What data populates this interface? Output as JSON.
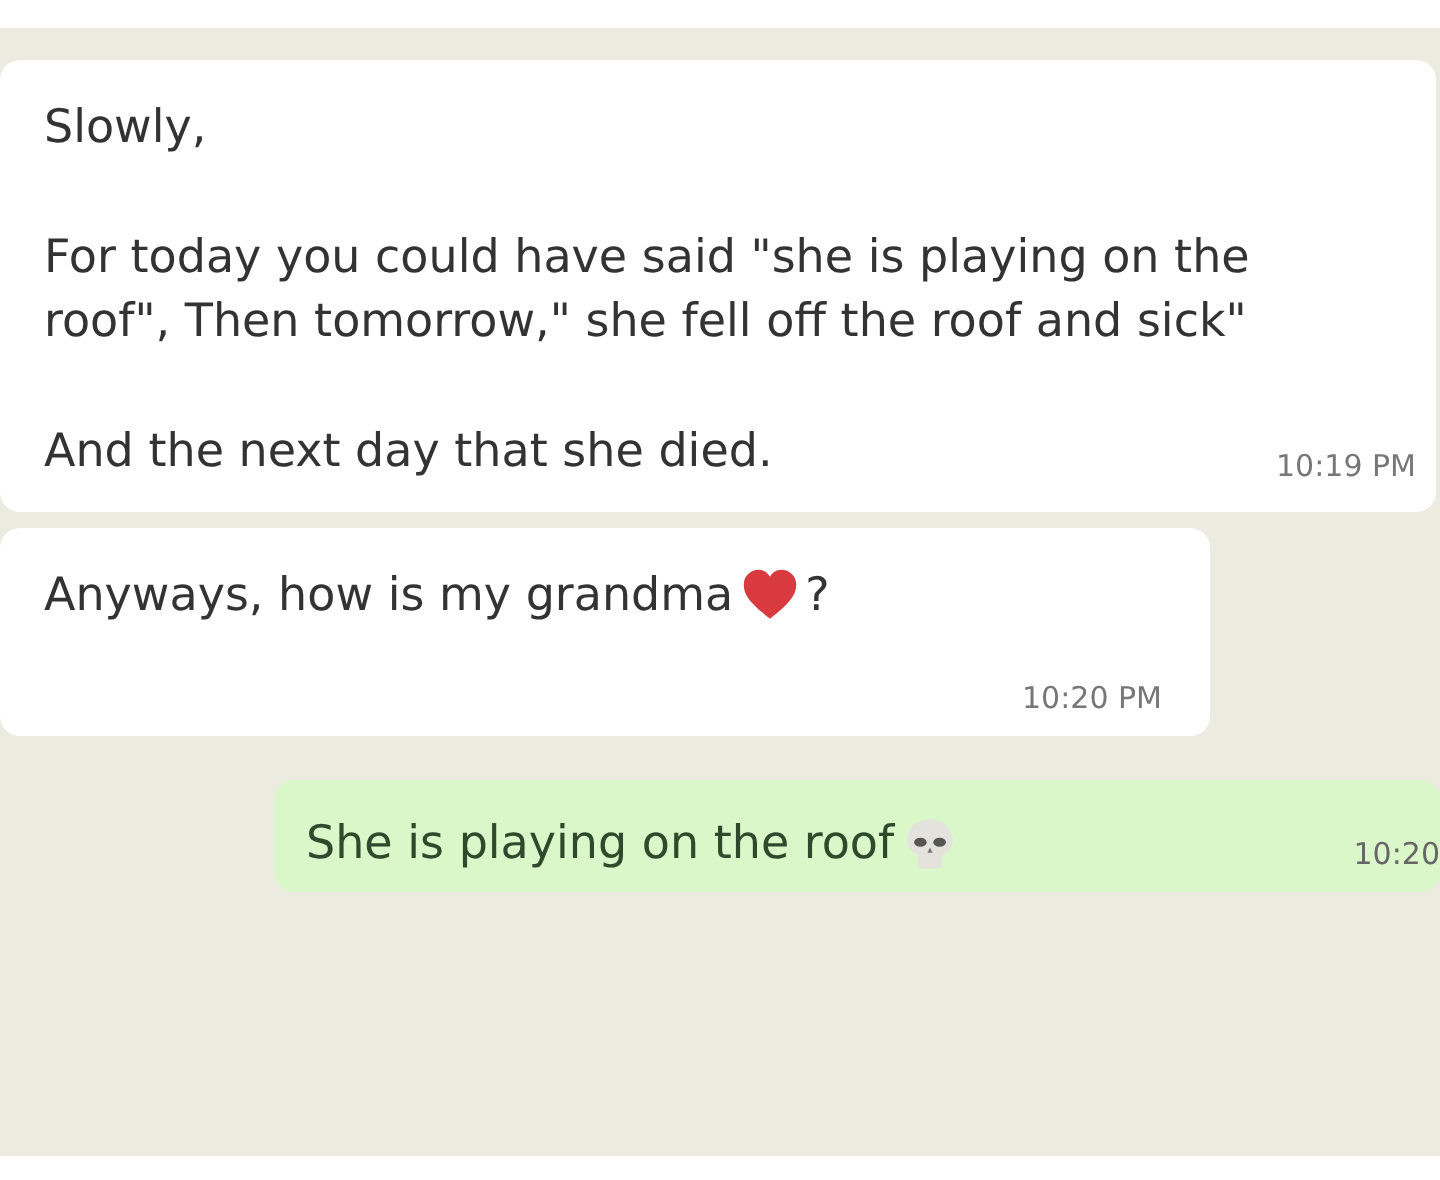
{
  "messages": [
    {
      "kind": "incoming",
      "paragraphs": [
        "Slowly,",
        "For today you could have said \"she is playing on the roof\", Then tomorrow,\" she fell off the roof and sick\"",
        "And the next day that she died."
      ],
      "time": "10:19 PM"
    },
    {
      "kind": "incoming",
      "parts": [
        {
          "kind": "text",
          "text": "Anyways, how is my grandma"
        },
        {
          "kind": "heart"
        },
        {
          "kind": "text",
          "text": "?"
        }
      ],
      "time": "10:20 PM"
    },
    {
      "kind": "outgoing",
      "parts": [
        {
          "kind": "text",
          "text": "She is playing on the roof"
        },
        {
          "kind": "skull"
        }
      ],
      "time": "10:20"
    }
  ]
}
